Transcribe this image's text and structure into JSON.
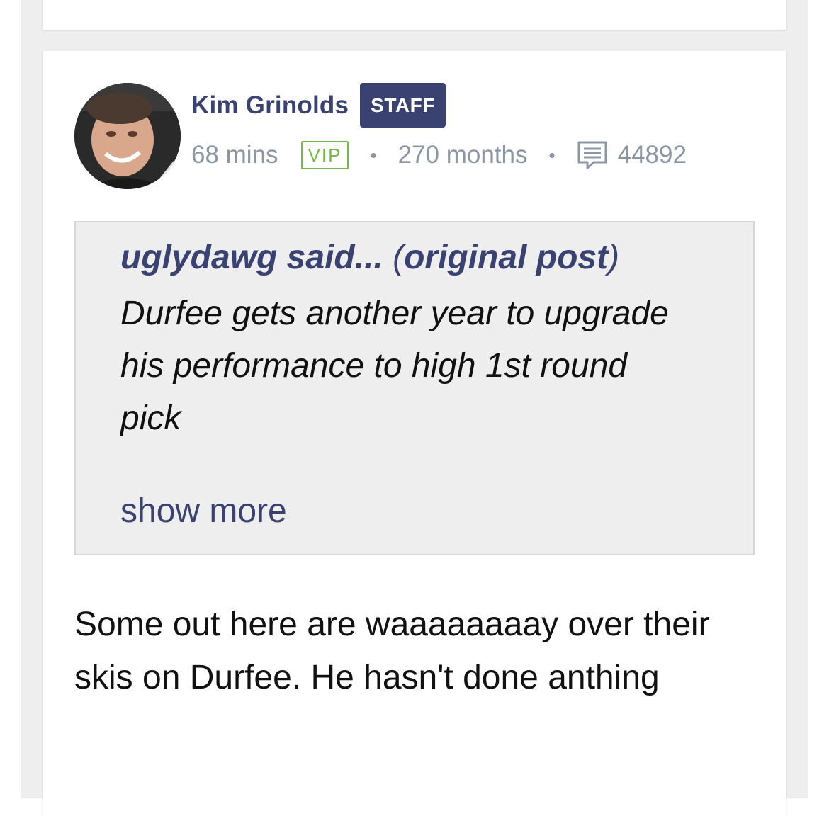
{
  "post": {
    "author": {
      "name": "Kim Grinolds",
      "badge": "STAFF",
      "avatar_alt": "avatar"
    },
    "meta": {
      "time_ago": "68 mins",
      "vip_label": "VIP",
      "separator": "•",
      "tenure": "270 months",
      "comment_icon": "comment-icon",
      "post_count": "44892"
    },
    "quote": {
      "username": "uglydawg said...",
      "open_paren": "(",
      "link_label": "original post",
      "close_paren": ")",
      "text": "Durfee gets another year to upgrade his performance to high 1st round pick",
      "show_more": "show more"
    },
    "body": "Some out here are waaaaaaaay over their skis on Durfee. He hasn't done anthing"
  },
  "colors": {
    "brand_navy": "#3a4272",
    "vip_green": "#77b946",
    "meta_gray": "#8c95a3",
    "page_gray": "#eeeeee"
  }
}
